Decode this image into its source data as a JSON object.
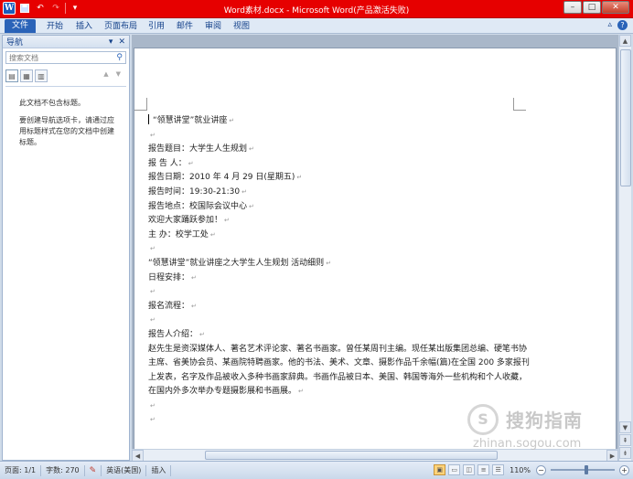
{
  "window": {
    "title": "Word素材.docx - Microsoft Word(产品激活失败)",
    "app_icon": "W",
    "accent_color": "#e60000"
  },
  "ribbon": {
    "tabs": [
      "文件",
      "开始",
      "插入",
      "页面布局",
      "引用",
      "邮件",
      "审阅",
      "视图"
    ],
    "help": "?"
  },
  "nav_pane": {
    "title": "导航",
    "search_placeholder": "搜索文档",
    "messages": [
      "此文档不包含标题。",
      "要创建导航选项卡，请通过应用标题样式在您的文档中创建标题。"
    ]
  },
  "document": {
    "lines": [
      "“领慧讲堂”就业讲座",
      "",
      "报告题目：大学生人生规划",
      "报  告  人：",
      "报告日期：2010 年 4 月 29 日(星期五)",
      "报告时间：19:30-21:30",
      "报告地点：校国际会议中心",
      "欢迎大家踊跃参加！",
      "主  办：校学工处",
      "",
      "“领慧讲堂”就业讲座之大学生人生规划  活动细则",
      "日程安排：",
      "",
      "报名流程：",
      "",
      "报告人介绍："
    ],
    "paragraph": "赵先生是资深媒体人、著名艺术评论家、著名书画家。曾任某周刊主编。现任某出版集团总编、硬笔书协主席、省美协会员、某画院特聘画家。他的书法、美术、文章、摄影作品千余幅(篇)在全国 200 多家报刊上发表，名字及作品被收入多种书画家辞典。书画作品被日本、美国、韩国等海外一些机构和个人收藏，在国内外多次举办专题摄影展和书画展。",
    "trailing_lines": [
      "",
      ""
    ],
    "paragraph_mark": "↵"
  },
  "status_bar": {
    "page": "页面: 1/1",
    "words": "字数: 270",
    "language": "英语(美国)",
    "mode": "插入",
    "zoom": "110%",
    "zoom_fraction": 0.55
  },
  "watermark": {
    "logo": "S",
    "title": "搜狗指南",
    "url": "zhinan.sogou.com"
  }
}
